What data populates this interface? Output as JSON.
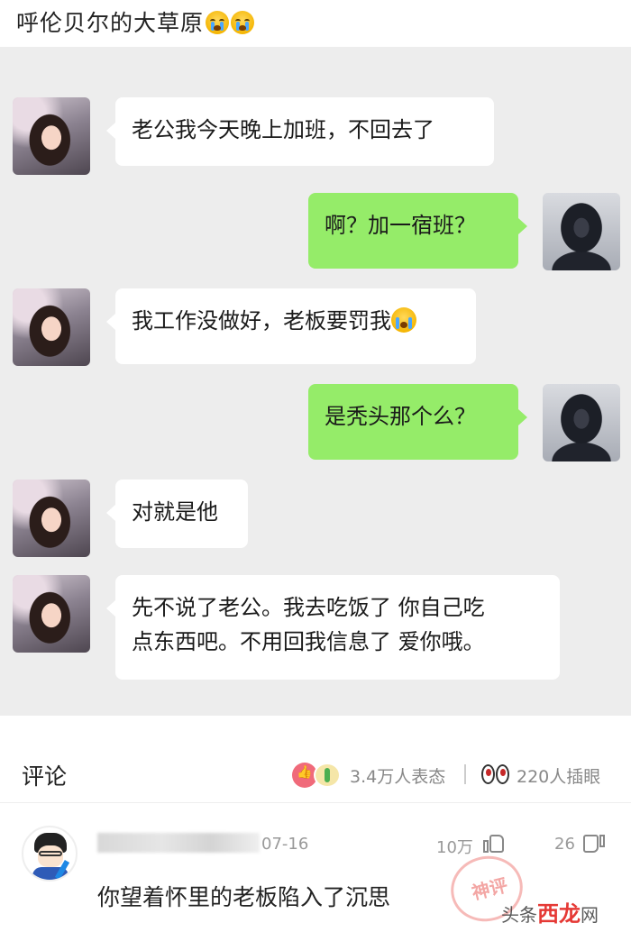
{
  "header": {
    "title": "呼伦贝尔的大草原",
    "emojis": [
      "crying-face",
      "crying-face"
    ]
  },
  "chat": {
    "messages": [
      {
        "side": "left",
        "text": "老公我今天晚上加班，不回去了"
      },
      {
        "side": "right",
        "text": "啊？加一宿班？"
      },
      {
        "side": "left",
        "text": "我工作没做好，老板要罚我",
        "emoji": "sob"
      },
      {
        "side": "right",
        "text": "是秃头那个么？"
      },
      {
        "side": "left",
        "text": "对就是他"
      },
      {
        "side": "left",
        "lines": [
          "先不说了老公。我去吃饭了 你自己吃",
          "点东西吧。不用回我信息了 爱你哦。"
        ]
      }
    ]
  },
  "comments": {
    "title": "评论",
    "reaction_count": "3.4万人表态",
    "eyes_count": "220人插眼",
    "items": [
      {
        "date": "07-16",
        "likes": "10万",
        "dislikes": "26",
        "text": "你望着怀里的老板陷入了沉思"
      }
    ]
  },
  "watermark": {
    "seal_text": "神评",
    "prefix": "头条",
    "accent": "西龙",
    "suffix": "网"
  },
  "colors": {
    "chat_bg": "#ededed",
    "out_bubble": "#95ec69",
    "in_bubble": "#ffffff"
  }
}
